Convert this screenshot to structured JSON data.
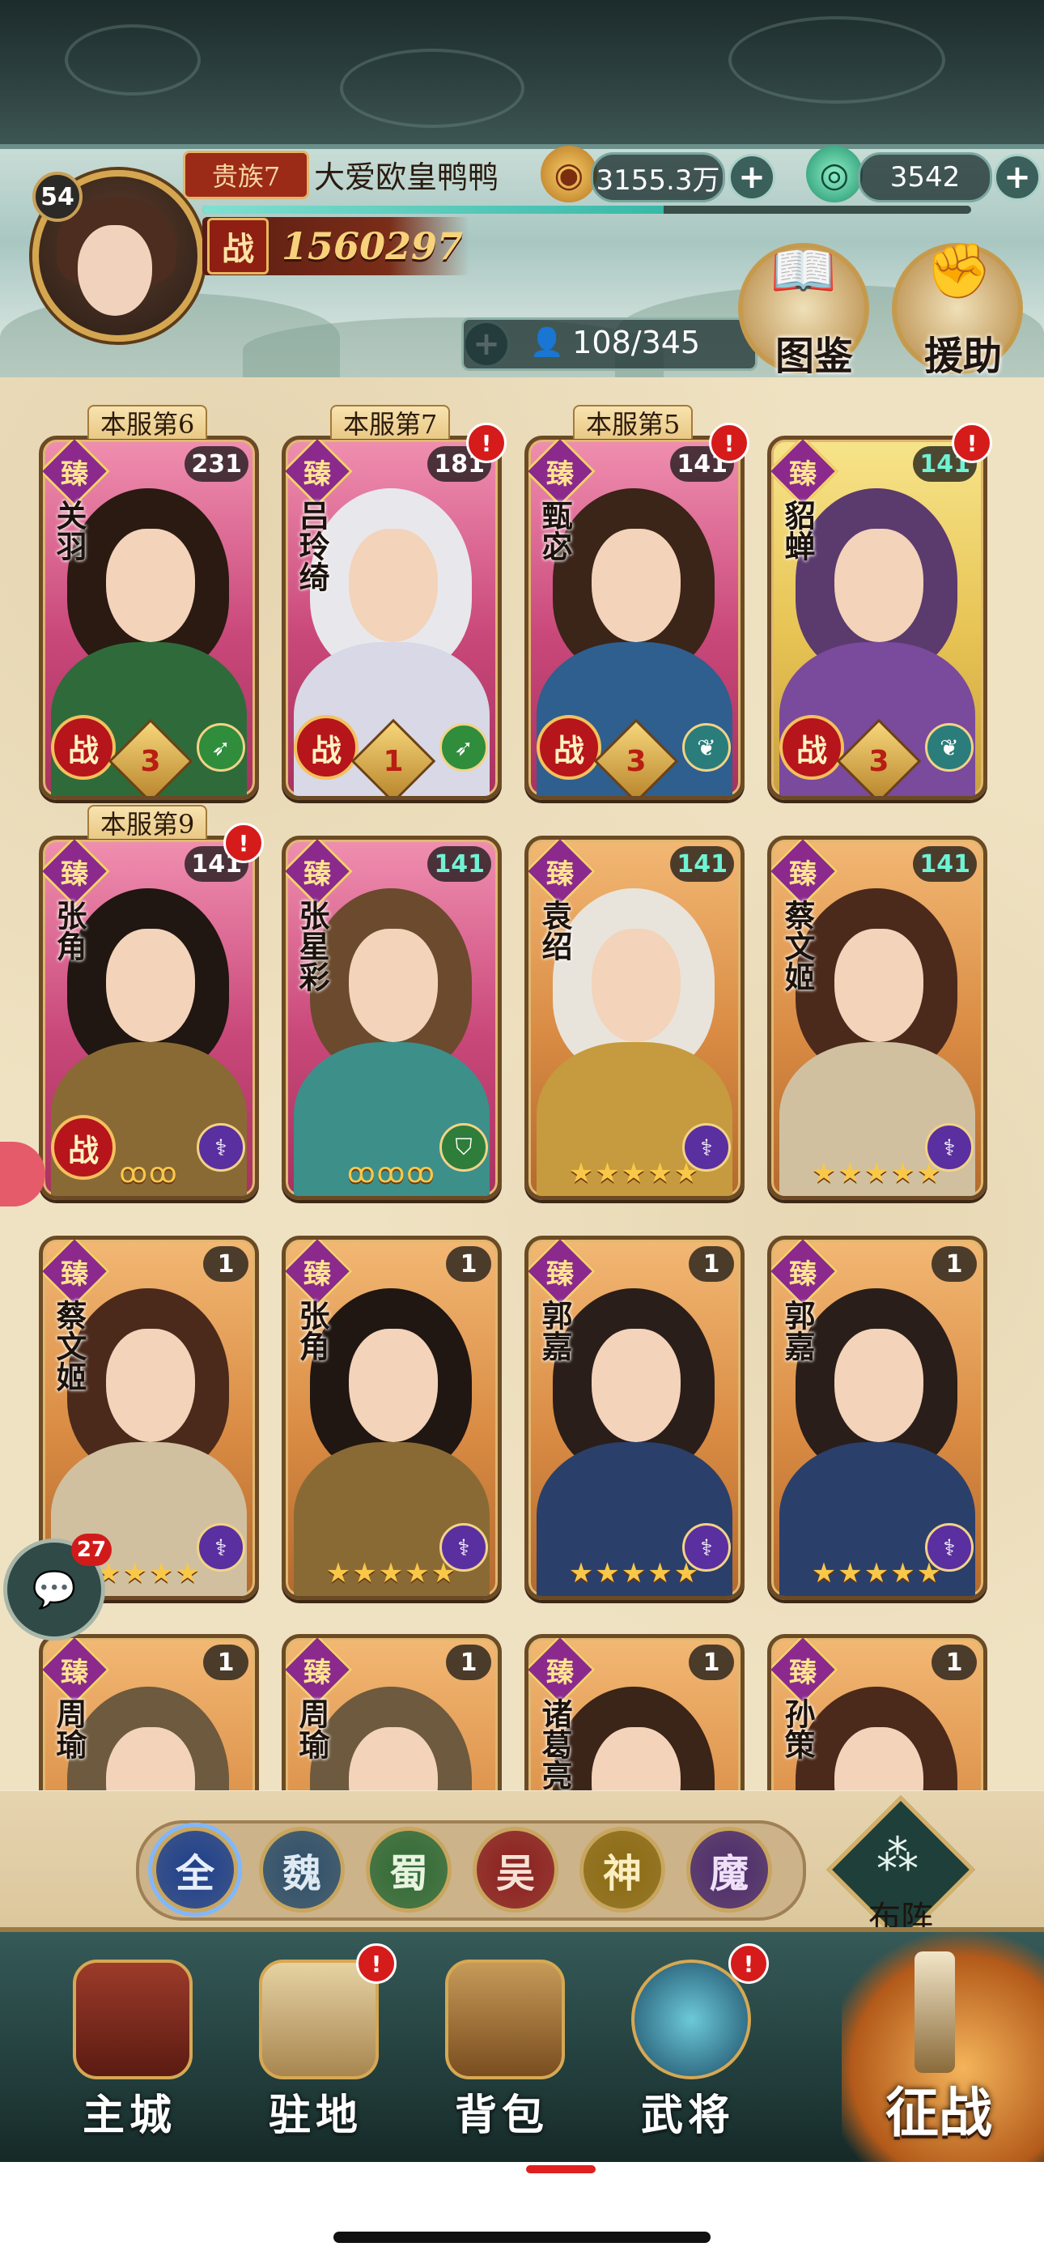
{
  "header": {
    "player_level": "54",
    "noble_rank": "贵族7",
    "player_name": "大爱欧皇鸭鸭",
    "gold": "3155.3万",
    "jade": "3542",
    "power_label": "战",
    "power": "1560297",
    "hero_count": "108/345",
    "buttons": {
      "codex": "图鉴",
      "assist": "援助"
    },
    "xp_progress": 0.6
  },
  "heroes": [
    {
      "name": "关羽",
      "level": "231",
      "rank_tag": "本服第6",
      "zhen": "臻",
      "in_battle": true,
      "battle_label": "战",
      "rank_badge": "3",
      "class_icon": "bow-icon",
      "color": "pink",
      "alert": false
    },
    {
      "name": "吕玲绮",
      "level": "181",
      "rank_tag": "本服第7",
      "zhen": "臻",
      "in_battle": true,
      "battle_label": "战",
      "rank_badge": "1",
      "class_icon": "bow-icon",
      "color": "pink",
      "alert": true
    },
    {
      "name": "甄宓",
      "level": "141",
      "rank_tag": "本服第5",
      "zhen": "臻",
      "in_battle": true,
      "battle_label": "战",
      "rank_badge": "3",
      "class_icon": "leaf-icon",
      "color": "pink",
      "alert": true
    },
    {
      "name": "貂蝉",
      "level": "141",
      "rank_tag": "",
      "zhen": "臻",
      "in_battle": true,
      "battle_label": "战",
      "rank_badge": "3",
      "class_icon": "leaf-icon",
      "color": "gold",
      "alert": true
    },
    {
      "name": "张角",
      "level": "141",
      "rank_tag": "本服第9",
      "zhen": "臻",
      "in_battle": true,
      "battle_label": "战",
      "stars": "ꝏꝏ",
      "class_icon": "staff-icon",
      "color": "pink",
      "alert": true
    },
    {
      "name": "张星彩",
      "level": "141",
      "rank_tag": "",
      "zhen": "臻",
      "in_battle": false,
      "stars": "ꝏꝏꝏ",
      "class_icon": "shield-icon",
      "color": "pink",
      "alert": false
    },
    {
      "name": "袁绍",
      "level": "141",
      "rank_tag": "",
      "zhen": "臻",
      "in_battle": false,
      "stars": "★★★★★",
      "class_icon": "staff-icon",
      "color": "orange",
      "alert": false
    },
    {
      "name": "蔡文姬",
      "level": "141",
      "rank_tag": "",
      "zhen": "臻",
      "in_battle": false,
      "stars": "★★★★★",
      "class_icon": "staff-icon",
      "color": "orange",
      "alert": false
    },
    {
      "name": "蔡文姬",
      "level": "1",
      "rank_tag": "",
      "zhen": "臻",
      "in_battle": false,
      "stars": "★★★★",
      "class_icon": "staff-icon",
      "color": "orange",
      "alert": false
    },
    {
      "name": "张角",
      "level": "1",
      "rank_tag": "",
      "zhen": "臻",
      "in_battle": false,
      "stars": "★★★★★",
      "class_icon": "staff-icon",
      "color": "orange",
      "alert": false
    },
    {
      "name": "郭嘉",
      "level": "1",
      "rank_tag": "",
      "zhen": "臻",
      "in_battle": false,
      "stars": "★★★★★",
      "class_icon": "staff-icon",
      "color": "orange",
      "alert": false
    },
    {
      "name": "郭嘉",
      "level": "1",
      "rank_tag": "",
      "zhen": "臻",
      "in_battle": false,
      "stars": "★★★★★",
      "class_icon": "staff-icon",
      "color": "orange",
      "alert": false
    },
    {
      "name": "周瑜",
      "level": "1",
      "rank_tag": "",
      "zhen": "臻",
      "in_battle": false,
      "stars": "",
      "class_icon": "",
      "color": "orange",
      "alert": false
    },
    {
      "name": "周瑜",
      "level": "1",
      "rank_tag": "",
      "zhen": "臻",
      "in_battle": false,
      "stars": "",
      "class_icon": "",
      "color": "orange",
      "alert": false
    },
    {
      "name": "诸葛亮",
      "level": "1",
      "rank_tag": "",
      "zhen": "臻",
      "in_battle": false,
      "stars": "",
      "class_icon": "",
      "color": "orange",
      "alert": false
    },
    {
      "name": "孙策",
      "level": "1",
      "rank_tag": "",
      "zhen": "臻",
      "in_battle": false,
      "stars": "",
      "class_icon": "",
      "color": "orange",
      "alert": false
    }
  ],
  "factions": [
    "全",
    "魏",
    "蜀",
    "吴",
    "神",
    "魔"
  ],
  "formation_label": "布阵",
  "chat": {
    "unread": "27"
  },
  "nav": {
    "main_city": "主城",
    "garrison": "驻地",
    "backpack": "背包",
    "generals": "武将",
    "battle": "征战"
  },
  "colors": {
    "accent_gold": "#d5a650",
    "alert_red": "#d61b1b",
    "nav_bg": "#1f3937"
  }
}
